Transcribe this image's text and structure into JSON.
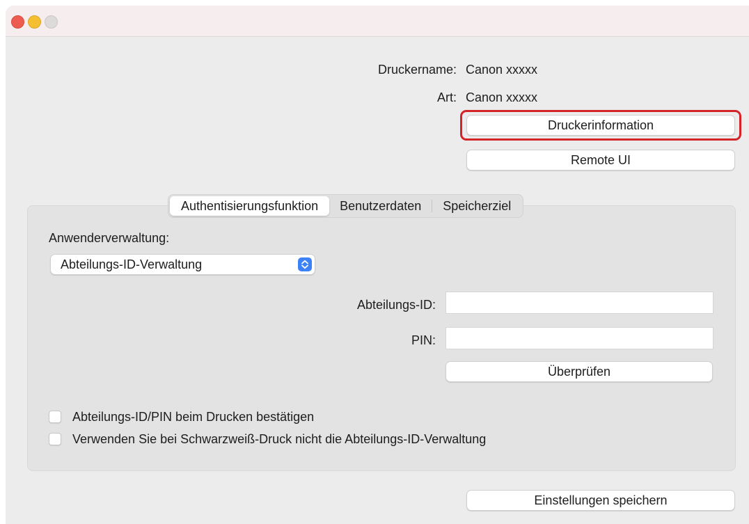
{
  "window": {
    "controls": [
      "close",
      "minimize",
      "zoom"
    ]
  },
  "info": {
    "printer_name_label": "Druckername:",
    "printer_name_value": "Canon xxxxx",
    "type_label": "Art:",
    "type_value": "Canon xxxxx"
  },
  "buttons": {
    "printer_info": "Druckerinformation",
    "remote_ui": "Remote UI",
    "verify": "Überprüfen",
    "save_settings": "Einstellungen speichern"
  },
  "highlight_color": "#d5232a",
  "tabs": [
    {
      "label": "Authentisierungsfunktion",
      "selected": true
    },
    {
      "label": "Benutzerdaten",
      "selected": false
    },
    {
      "label": "Speicherziel",
      "selected": false
    }
  ],
  "auth": {
    "user_management_label": "Anwenderverwaltung:",
    "user_management_value": "Abteilungs-ID-Verwaltung",
    "dept_id_label": "Abteilungs-ID:",
    "dept_id_value": "",
    "pin_label": "PIN:",
    "pin_value": "",
    "confirm_checkbox_label": "Abteilungs-ID/PIN beim Drucken bestätigen",
    "confirm_checked": false,
    "bw_checkbox_label": "Verwenden Sie bei Schwarzweiß-Druck nicht die Abteilungs-ID-Verwaltung",
    "bw_checked": false
  }
}
